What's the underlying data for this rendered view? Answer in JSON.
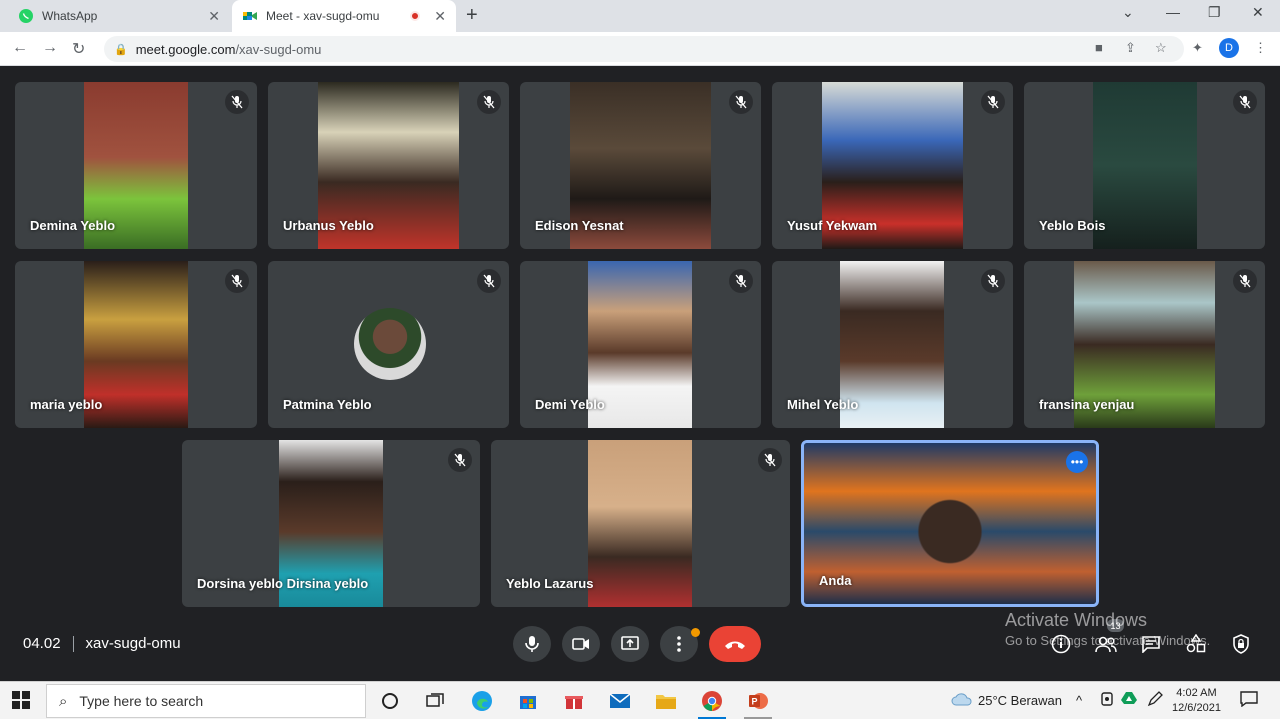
{
  "browser": {
    "tabs": [
      {
        "title": "WhatsApp",
        "favicon": "whatsapp-icon",
        "color": "#25d366"
      },
      {
        "title": "Meet - xav-sugd-omu",
        "favicon": "google-meet-icon",
        "color": "#00897b"
      }
    ],
    "url_host": "meet.google.com",
    "url_path": "/xav-sugd-omu",
    "profile_initial": "D"
  },
  "participants": [
    {
      "name": "Demina Yeblo",
      "muted": true
    },
    {
      "name": "Urbanus Yeblo",
      "muted": true
    },
    {
      "name": "Edison Yesnat",
      "muted": true
    },
    {
      "name": "Yusuf Yekwam",
      "muted": true
    },
    {
      "name": "Yeblo Bois",
      "muted": true
    },
    {
      "name": "maria yeblo",
      "muted": true
    },
    {
      "name": "Patmina Yeblo",
      "muted": true
    },
    {
      "name": "Demi Yeblo",
      "muted": true
    },
    {
      "name": "Mihel Yeblo",
      "muted": true
    },
    {
      "name": "fransina yenjau",
      "muted": true
    },
    {
      "name": "Dorsina yeblo Dirsina yeblo",
      "muted": true
    },
    {
      "name": "Yeblo Lazarus",
      "muted": true
    },
    {
      "name": "Anda",
      "muted": false
    }
  ],
  "meeting": {
    "time": "04.02",
    "code": "xav-sugd-omu",
    "people_count": "13"
  },
  "watermark": {
    "line1": "Activate Windows",
    "line2": "Go to Settings to activate Windows."
  },
  "taskbar": {
    "search_placeholder": "Type here to search",
    "weather": "25°C  Berawan",
    "time": "4:02 AM",
    "date": "12/6/2021"
  },
  "colors": {
    "meet_bg": "#202124",
    "tile_bg": "#3c4043",
    "hangup": "#ea4335",
    "self_border": "#8ab4f8",
    "accent": "#1a73e8"
  }
}
